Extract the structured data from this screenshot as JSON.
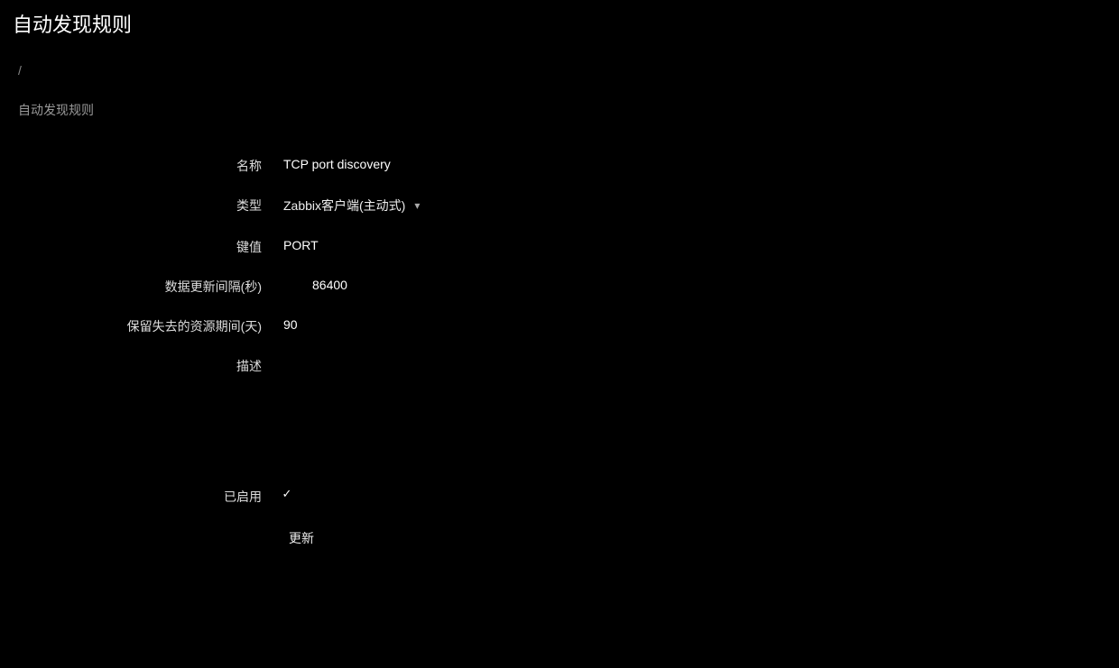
{
  "page": {
    "title": "自动发现规则"
  },
  "breadcrumb": {
    "sep": "/"
  },
  "tabs": {
    "active": "自动发现规则"
  },
  "form": {
    "name": {
      "label": "名称",
      "value": "TCP port discovery"
    },
    "type": {
      "label": "类型",
      "value": "Zabbix客户端(主动式)"
    },
    "key": {
      "label": "键值",
      "value": "PORT"
    },
    "interval": {
      "label": "数据更新间隔(秒)",
      "value": "86400"
    },
    "keep_lost": {
      "label": "保留失去的资源期间(天)",
      "value": "90"
    },
    "description": {
      "label": "描述",
      "value": ""
    },
    "enabled": {
      "label": "已启用",
      "checked": true,
      "checkmark": "✓"
    },
    "submit": {
      "label": "更新"
    }
  }
}
